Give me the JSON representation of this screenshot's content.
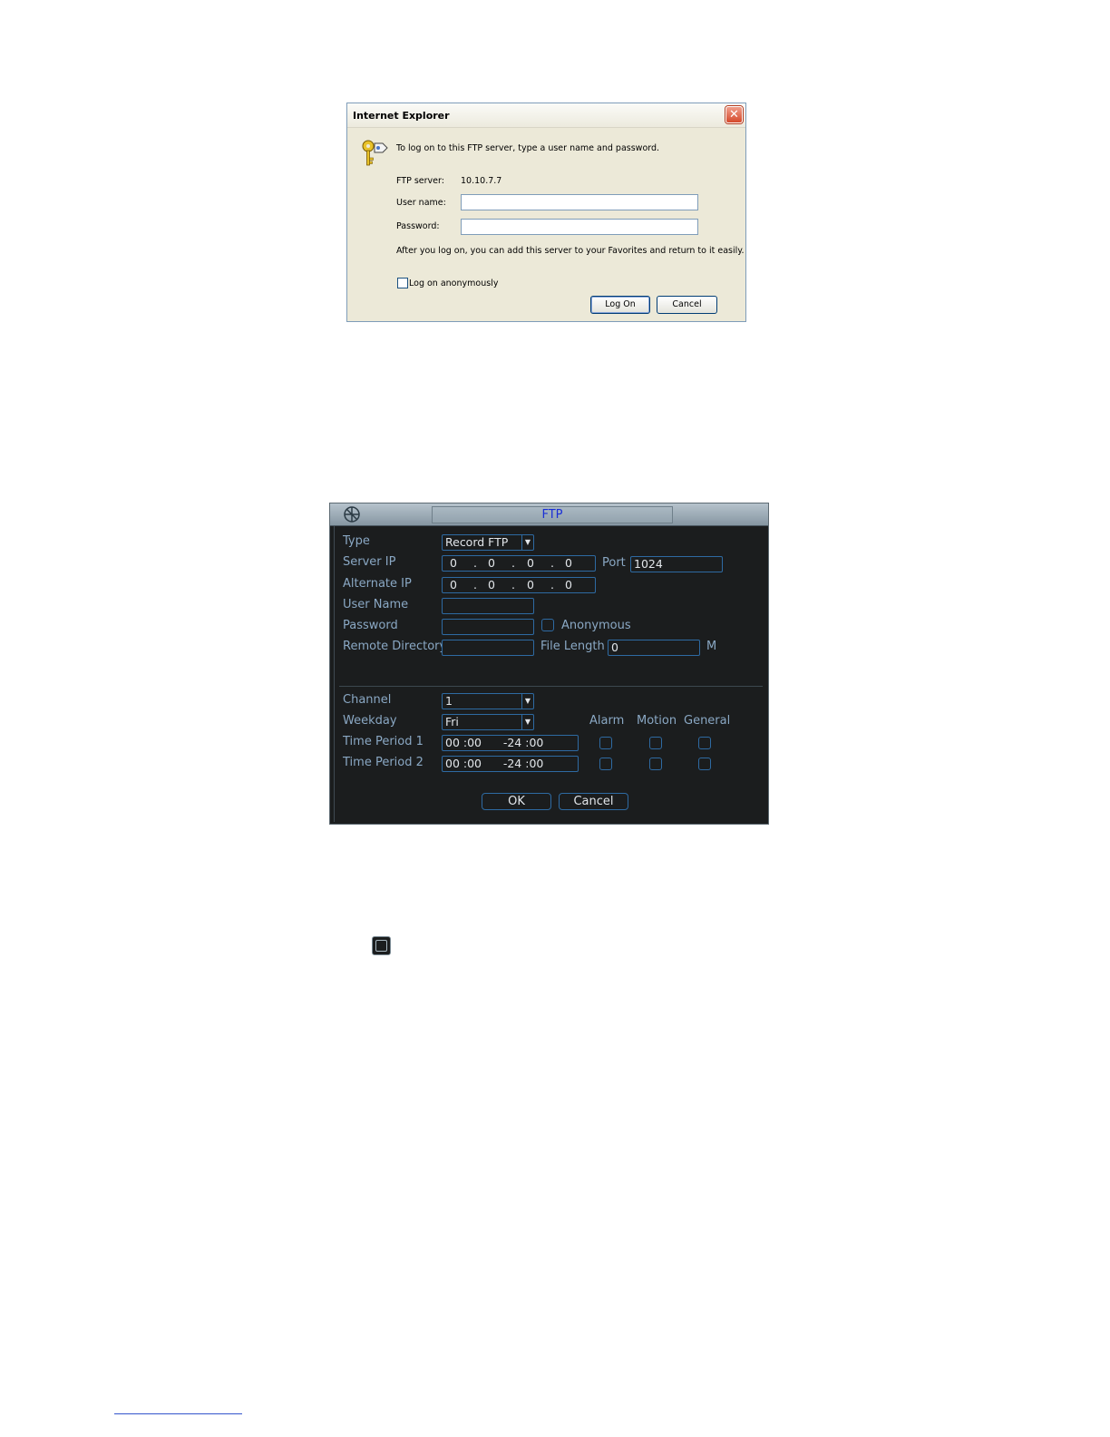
{
  "ie_dialog": {
    "title": "Internet Explorer",
    "close_symbol": "✕",
    "prompt": "To log on to this FTP server, type a user name and password.",
    "server_label": "FTP server:",
    "server_value": "10.10.7.7",
    "username_label": "User name:",
    "password_label": "Password:",
    "info": "After you log on, you can add this server to your Favorites and return to it easily.",
    "anonymous_label": "Log on anonymously",
    "logon_button": "Log On",
    "cancel_button": "Cancel",
    "icon": "keys-icon"
  },
  "ftp_panel": {
    "title": "FTP",
    "logo_icon": "dvr-logo-icon",
    "labels": {
      "type": "Type",
      "server_ip": "Server IP",
      "port": "Port",
      "alternate_ip": "Alternate IP",
      "user_name": "User Name",
      "password": "Password",
      "anonymous": "Anonymous",
      "remote_directory": "Remote Directory",
      "file_length": "File Length",
      "file_length_unit": "M",
      "channel": "Channel",
      "weekday": "Weekday",
      "alarm": "Alarm",
      "motion": "Motion",
      "general": "General",
      "time_period_1": "Time Period 1",
      "time_period_2": "Time Period 2"
    },
    "values": {
      "type": "Record FTP",
      "server_ip": [
        "0",
        "0",
        "0",
        "0"
      ],
      "port": "1024",
      "alternate_ip": [
        "0",
        "0",
        "0",
        "0"
      ],
      "user_name": "",
      "password": "",
      "remote_directory": "",
      "file_length": "0",
      "channel": "1",
      "weekday": "Fri",
      "time_period_1": "00 :00      -24 :00",
      "time_period_2": "00 :00      -24 :00",
      "dropdown_arrow": "▼",
      "ip_dot": "."
    },
    "buttons": {
      "ok": "OK",
      "cancel": "Cancel"
    },
    "colors": {
      "background": "#1b1d1e",
      "label": "#8aa8c4",
      "border": "#2e6aa2",
      "title": "#1a2fd6"
    }
  }
}
